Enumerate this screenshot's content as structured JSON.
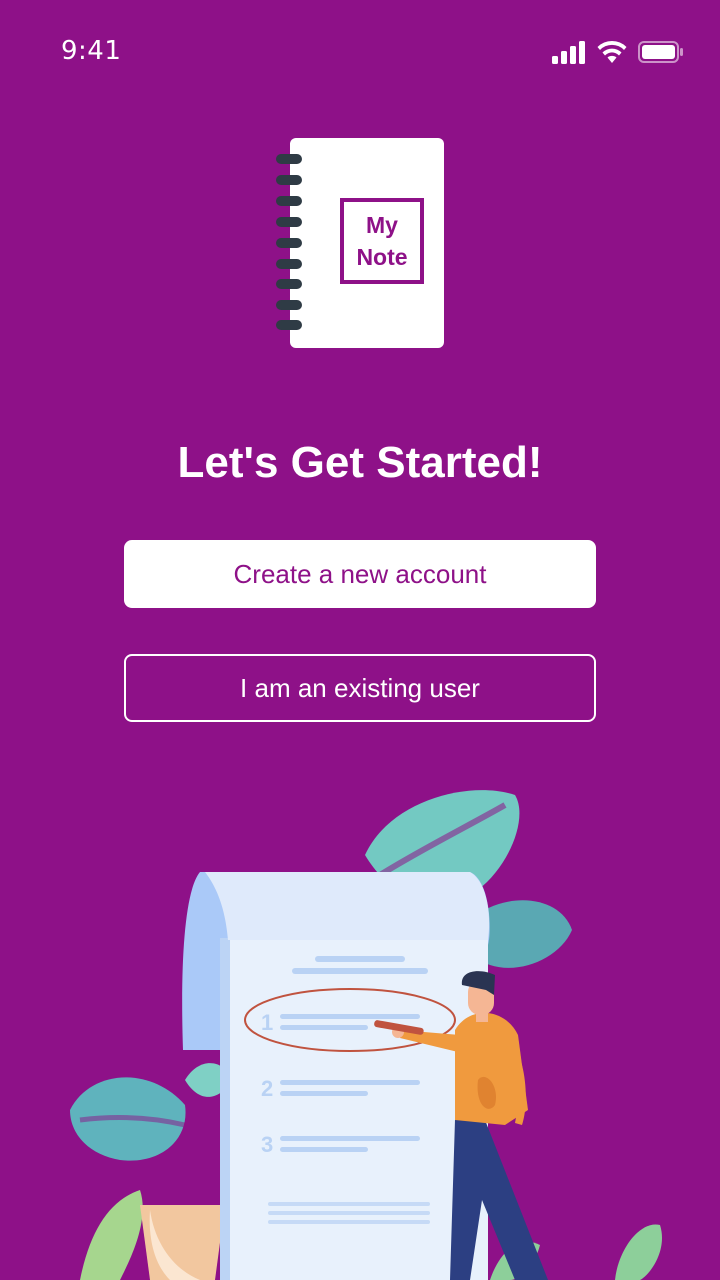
{
  "status_bar": {
    "time": "9:41"
  },
  "logo": {
    "line1": "My",
    "line2": "Note"
  },
  "onboarding": {
    "title": "Let's Get Started!",
    "create_account_label": "Create a new account",
    "existing_user_label": "I am an existing user"
  },
  "illustration": {
    "step_numbers": [
      "1",
      "2",
      "3"
    ]
  },
  "colors": {
    "background": "#8e1188",
    "primary_text": "#8e1188",
    "white": "#ffffff"
  },
  "icons": [
    "signal-icon",
    "wifi-icon",
    "battery-icon"
  ]
}
